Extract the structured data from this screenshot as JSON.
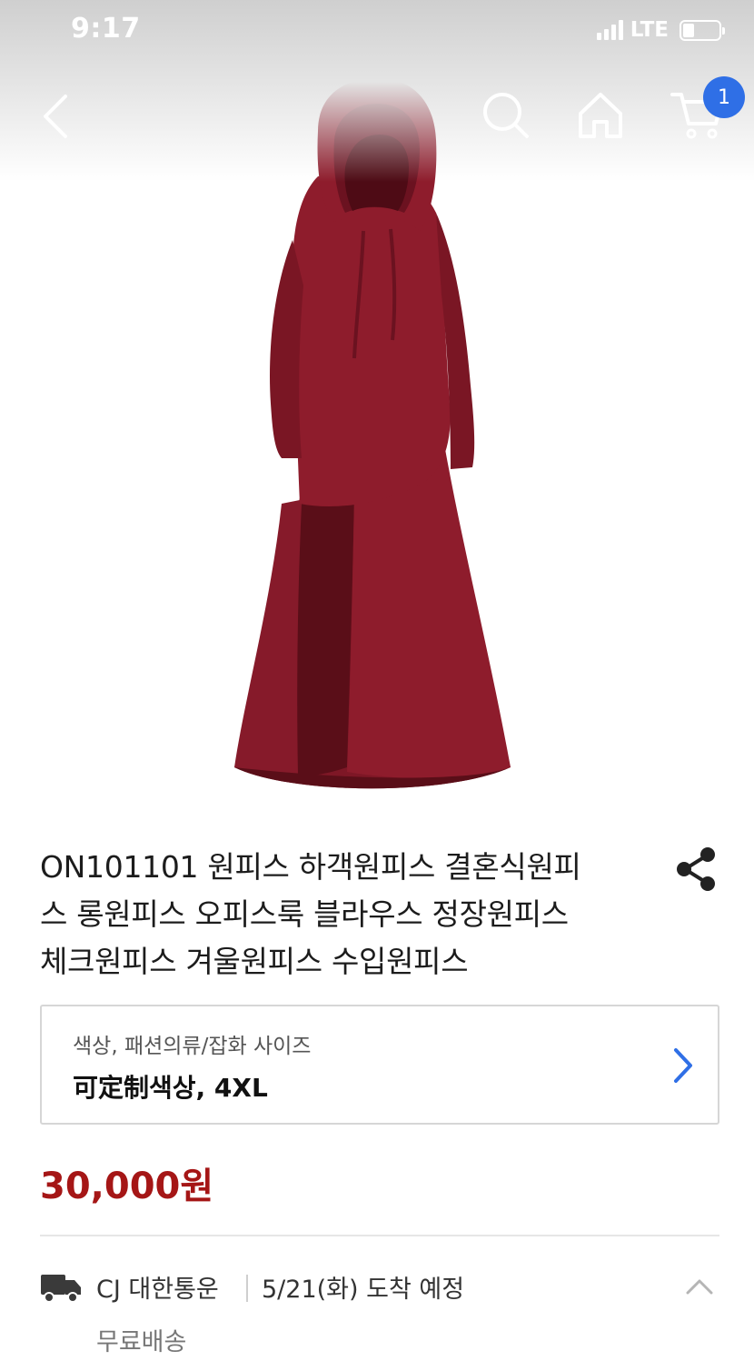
{
  "status_bar": {
    "time": "9:17",
    "network": "LTE"
  },
  "top_nav": {
    "back_icon": "chevron-left-icon",
    "search_icon": "search-icon",
    "home_icon": "home-icon",
    "cart_icon": "cart-icon",
    "cart_count": "1"
  },
  "product": {
    "title": "ON101101 원피스 하객원피스 결혼식원피스 롱원피스 오피스룩 블라우스 정장원피스 체크원피스 겨울원피스 수입원피스",
    "title_lines": [
      "ON101101 원피스 하객원피스 결혼식원피",
      "스 롱원피스 오피스룩 블라우스 정장원피스",
      "체크원피스 겨울원피스 수입원피스"
    ],
    "share_icon": "share-icon",
    "dress_color": "#8e1c2c"
  },
  "option": {
    "label": "색상, 패션의류/잡화 사이즈",
    "value": "可定制색상, 4XL",
    "chevron_color": "#2f6fe6"
  },
  "price": {
    "text": "30,000원",
    "color": "#a51616"
  },
  "delivery": {
    "courier": "CJ 대한통운",
    "eta": "5/21(화) 도착 예정",
    "fee": "무료배송"
  }
}
